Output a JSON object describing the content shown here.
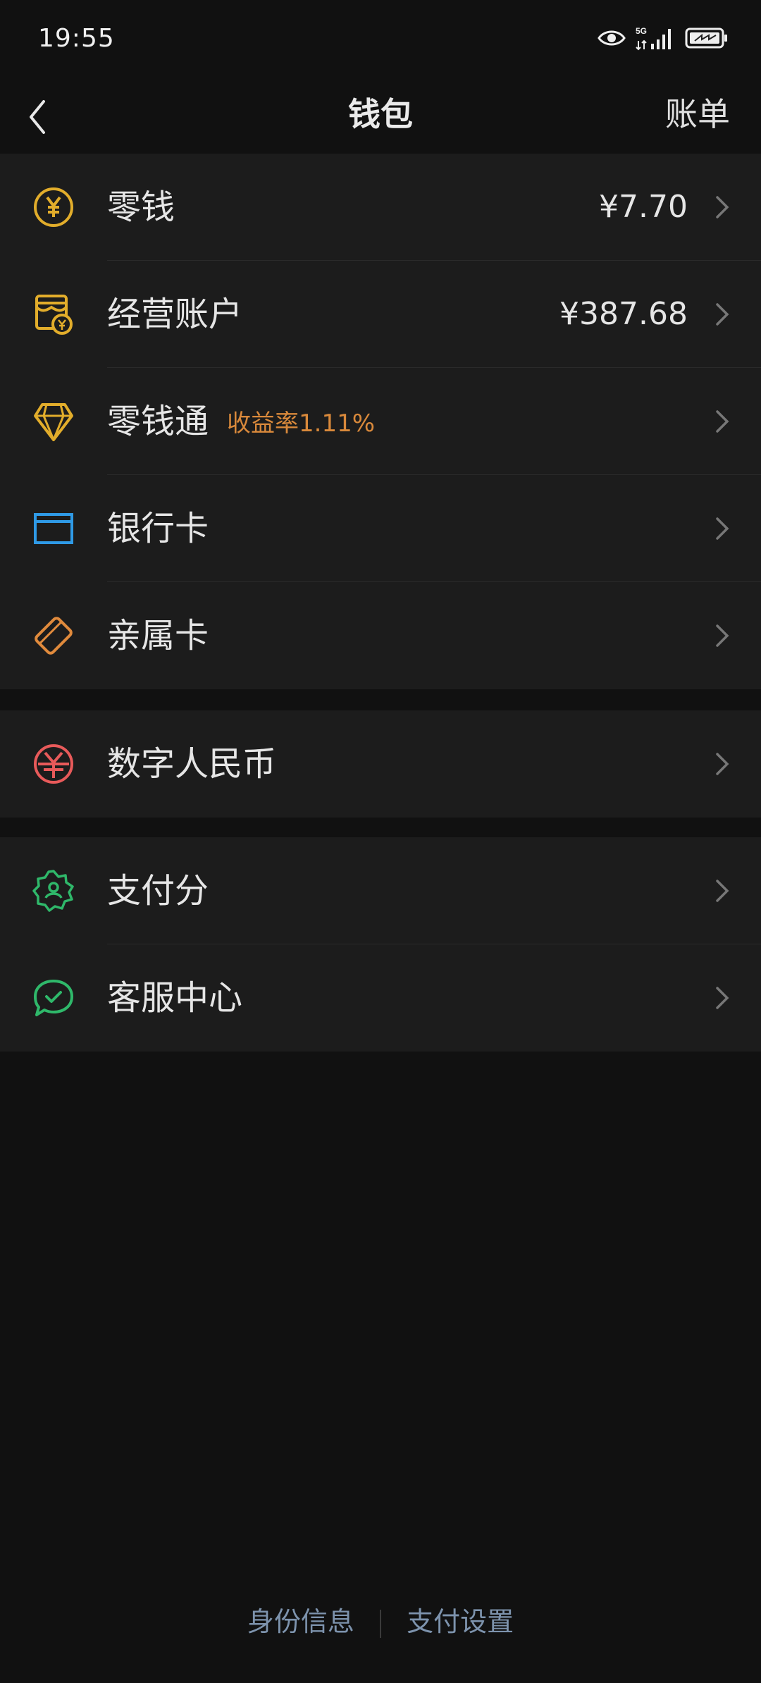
{
  "status_bar": {
    "time": "19:55",
    "network": "5G"
  },
  "nav": {
    "title": "钱包",
    "right_action": "账单"
  },
  "group1": [
    {
      "label": "零钱",
      "value": "¥7.70",
      "icon": "yuan-coin-icon",
      "color": "#e2ad2b"
    },
    {
      "label": "经营账户",
      "value": "¥387.68",
      "icon": "store-account-icon",
      "color": "#e2ad2b"
    },
    {
      "label": "零钱通",
      "tag": "收益率1.11%",
      "icon": "diamond-icon",
      "color": "#e2ad2b"
    },
    {
      "label": "银行卡",
      "icon": "bank-card-icon",
      "color": "#2f9ae6"
    },
    {
      "label": "亲属卡",
      "icon": "family-card-icon",
      "color": "#e08a3c"
    }
  ],
  "group2": [
    {
      "label": "数字人民币",
      "icon": "digital-rmb-icon",
      "color": "#e85a5a"
    }
  ],
  "group3": [
    {
      "label": "支付分",
      "icon": "pay-score-icon",
      "color": "#2fb86a"
    },
    {
      "label": "客服中心",
      "icon": "customer-service-icon",
      "color": "#2fb86a"
    }
  ],
  "footer": {
    "identity": "身份信息",
    "pay_settings": "支付设置"
  }
}
